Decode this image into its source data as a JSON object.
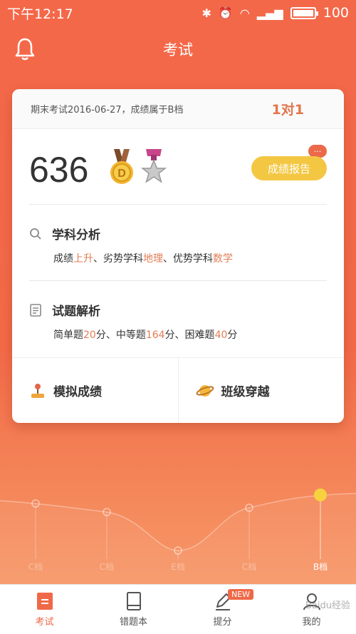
{
  "status": {
    "time": "下午12:17",
    "battery": "100"
  },
  "header": {
    "title": "考试"
  },
  "card": {
    "exam_info": "期末考试2016-06-27，成绩属于B档",
    "one_on_one": "1对1",
    "score": "636",
    "report_button": "成绩报告",
    "bubble": "···",
    "subject": {
      "title": "学科分析",
      "p1": "成绩",
      "v1": "上升",
      "p2": "、劣势学科",
      "v2": "地理",
      "p3": "、优势学科",
      "v3": "数学"
    },
    "questions": {
      "title": "试题解析",
      "p1": "简单题",
      "v1": "20",
      "p2": "分、中等题",
      "v2": "164",
      "p3": "分、困难题",
      "v3": "40",
      "p4": "分"
    },
    "simulate": "模拟成绩",
    "class_cross": "班级穿越"
  },
  "curve": {
    "grades": [
      "C档",
      "C档",
      "E档",
      "C档",
      "B档"
    ],
    "active_index": 4
  },
  "tabs": [
    {
      "label": "考试",
      "icon": "exam-icon"
    },
    {
      "label": "错题本",
      "icon": "notebook-icon"
    },
    {
      "label": "提分",
      "icon": "pencil-icon",
      "badge": "NEW"
    },
    {
      "label": "我的",
      "icon": "profile-icon"
    }
  ],
  "watermark": "Baidu经验",
  "colors": {
    "accent": "#ef6948",
    "highlight": "#e27d56",
    "report_button": "#f4c743"
  }
}
